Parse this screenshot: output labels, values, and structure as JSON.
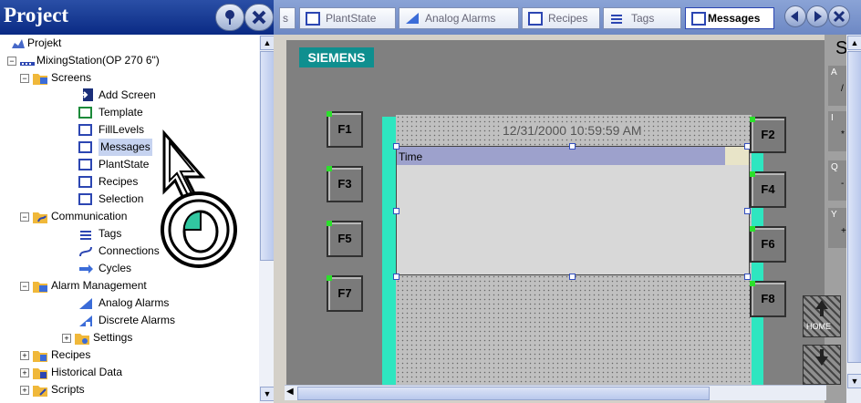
{
  "project_pane": {
    "title": "Project",
    "tree": [
      {
        "label": "Projekt",
        "icon": "project-icon"
      },
      {
        "label": "MixingStation(OP 270 6\")",
        "icon": "device-icon"
      },
      {
        "label": "Screens",
        "icon": "folder-icon"
      },
      {
        "label": "Add Screen",
        "icon": "add-screen-icon"
      },
      {
        "label": "Template",
        "icon": "screen-icon"
      },
      {
        "label": "FillLevels",
        "icon": "screen-icon"
      },
      {
        "label": "Messages",
        "icon": "screen-icon"
      },
      {
        "label": "PlantState",
        "icon": "screen-icon"
      },
      {
        "label": "Recipes",
        "icon": "screen-icon"
      },
      {
        "label": "Selection",
        "icon": "screen-icon"
      },
      {
        "label": "Communication",
        "icon": "folder-icon"
      },
      {
        "label": "Tags",
        "icon": "tags-icon"
      },
      {
        "label": "Connections",
        "icon": "connections-icon"
      },
      {
        "label": "Cycles",
        "icon": "cycles-icon"
      },
      {
        "label": "Alarm Management",
        "icon": "folder-icon"
      },
      {
        "label": "Analog Alarms",
        "icon": "analog-alarm-icon"
      },
      {
        "label": "Discrete Alarms",
        "icon": "discrete-alarm-icon"
      },
      {
        "label": "Settings",
        "icon": "settings-icon"
      },
      {
        "label": "Recipes",
        "icon": "folder-icon"
      },
      {
        "label": "Historical Data",
        "icon": "folder-icon"
      },
      {
        "label": "Scripts",
        "icon": "folder-icon"
      }
    ]
  },
  "tabs": [
    {
      "label": "s"
    },
    {
      "label": "PlantState"
    },
    {
      "label": "Analog Alarms"
    },
    {
      "label": "Recipes"
    },
    {
      "label": "Tags"
    },
    {
      "label": "Messages",
      "active": true
    }
  ],
  "screen": {
    "brand": "SIEMENS",
    "clock": "12/31/2000 10:59:59 AM",
    "alarm_column": "Time",
    "fkeys_left": [
      "F1",
      "F3",
      "F5",
      "F7"
    ],
    "fkeys_right": [
      "F2",
      "F4",
      "F6",
      "F8"
    ],
    "side_letter": "S",
    "system_keys": [
      {
        "top": "A",
        "bottom": "/"
      },
      {
        "top": "I",
        "bottom": "*"
      },
      {
        "top": "Q",
        "bottom": "-"
      },
      {
        "top": "Y",
        "bottom": "+"
      }
    ],
    "home_label": "HOME"
  },
  "colors": {
    "accent": "#0f8f8f",
    "frame": "#2ee6c0",
    "title_bar": "#0a2a84"
  }
}
